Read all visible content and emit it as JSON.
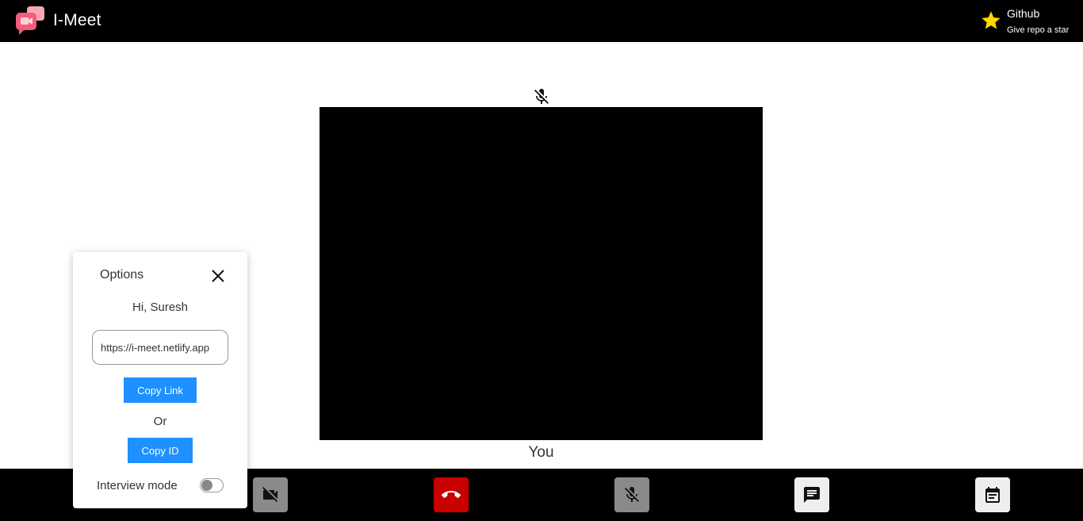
{
  "header": {
    "app_title": "I-Meet",
    "github_title": "Github",
    "github_subtitle": "Give repo a star"
  },
  "video": {
    "label": "You",
    "mic_status_icon": "mic-off-icon"
  },
  "options": {
    "title": "Options",
    "greeting": "Hi, Suresh",
    "link_value": "https://i-meet.netlify.app",
    "copy_link_label": "Copy Link",
    "or_label": "Or",
    "copy_id_label": "Copy ID",
    "interview_mode_label": "Interview mode",
    "interview_mode_on": false
  },
  "controls": [
    {
      "icon": "video-off-icon"
    },
    {
      "icon": "end-call-icon"
    },
    {
      "icon": "mic-off-icon"
    },
    {
      "icon": "chat-icon"
    },
    {
      "icon": "calendar-icon"
    }
  ],
  "colors": {
    "header_bg": "#000000",
    "accent_blue": "#1e90ff",
    "end_call_red": "#c80000",
    "star_yellow": "#ffd700"
  }
}
